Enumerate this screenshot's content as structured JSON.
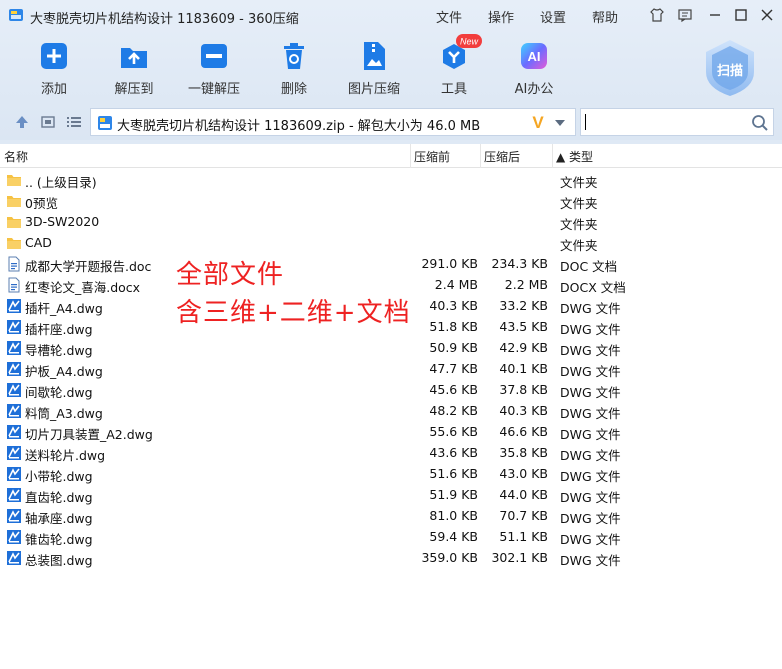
{
  "window": {
    "title": "大枣脱壳切片机结构设计 1183609 - 360压缩",
    "menus": [
      "文件",
      "操作",
      "设置",
      "帮助"
    ]
  },
  "toolbar": {
    "items": [
      {
        "label": "添加",
        "icon": "add-icon"
      },
      {
        "label": "解压到",
        "icon": "extract-to-icon"
      },
      {
        "label": "一键解压",
        "icon": "one-click-extract-icon"
      },
      {
        "label": "删除",
        "icon": "trash-icon"
      },
      {
        "label": "图片压缩",
        "icon": "image-compress-icon"
      },
      {
        "label": "工具",
        "icon": "tools-icon",
        "badge": "New"
      },
      {
        "label": "AI办公",
        "icon": "ai-icon",
        "badge_text": "AI"
      }
    ],
    "scan_label": "扫描"
  },
  "address": {
    "path": "大枣脱壳切片机结构设计 1183609.zip - 解包大小为 46.0 MB",
    "v_badge": "V",
    "search_value": ""
  },
  "columns": {
    "name": "名称",
    "packed": "压缩前",
    "compressed": "压缩后",
    "type": "▲ 类型"
  },
  "files": [
    {
      "name": ".. (上级目录)",
      "before": "",
      "after": "",
      "type": "文件夹",
      "kind": "folder"
    },
    {
      "name": "0预览",
      "before": "",
      "after": "",
      "type": "文件夹",
      "kind": "folder"
    },
    {
      "name": "3D-SW2020",
      "before": "",
      "after": "",
      "type": "文件夹",
      "kind": "folder"
    },
    {
      "name": "CAD",
      "before": "",
      "after": "",
      "type": "文件夹",
      "kind": "folder"
    },
    {
      "name": "成都大学开题报告.doc",
      "before": "291.0 KB",
      "after": "234.3 KB",
      "type": "DOC 文档",
      "kind": "doc"
    },
    {
      "name": "红枣论文_喜海.docx",
      "before": "2.4 MB",
      "after": "2.2 MB",
      "type": "DOCX 文档",
      "kind": "doc"
    },
    {
      "name": "插杆_A4.dwg",
      "before": "40.3 KB",
      "after": "33.2 KB",
      "type": "DWG 文件",
      "kind": "dwg"
    },
    {
      "name": "插杆座.dwg",
      "before": "51.8 KB",
      "after": "43.5 KB",
      "type": "DWG 文件",
      "kind": "dwg"
    },
    {
      "name": "导槽轮.dwg",
      "before": "50.9 KB",
      "after": "42.9 KB",
      "type": "DWG 文件",
      "kind": "dwg"
    },
    {
      "name": "护板_A4.dwg",
      "before": "47.7 KB",
      "after": "40.1 KB",
      "type": "DWG 文件",
      "kind": "dwg"
    },
    {
      "name": "间歇轮.dwg",
      "before": "45.6 KB",
      "after": "37.8 KB",
      "type": "DWG 文件",
      "kind": "dwg"
    },
    {
      "name": "料筒_A3.dwg",
      "before": "48.2 KB",
      "after": "40.3 KB",
      "type": "DWG 文件",
      "kind": "dwg"
    },
    {
      "name": "切片刀具装置_A2.dwg",
      "before": "55.6 KB",
      "after": "46.6 KB",
      "type": "DWG 文件",
      "kind": "dwg"
    },
    {
      "name": "送料轮片.dwg",
      "before": "43.6 KB",
      "after": "35.8 KB",
      "type": "DWG 文件",
      "kind": "dwg"
    },
    {
      "name": "小带轮.dwg",
      "before": "51.6 KB",
      "after": "43.0 KB",
      "type": "DWG 文件",
      "kind": "dwg"
    },
    {
      "name": "直齿轮.dwg",
      "before": "51.9 KB",
      "after": "44.0 KB",
      "type": "DWG 文件",
      "kind": "dwg"
    },
    {
      "name": "轴承座.dwg",
      "before": "81.0 KB",
      "after": "70.7 KB",
      "type": "DWG 文件",
      "kind": "dwg"
    },
    {
      "name": "锥齿轮.dwg",
      "before": "59.4 KB",
      "after": "51.1 KB",
      "type": "DWG 文件",
      "kind": "dwg"
    },
    {
      "name": "总装图.dwg",
      "before": "359.0 KB",
      "after": "302.1 KB",
      "type": "DWG 文件",
      "kind": "dwg"
    }
  ],
  "overlay": {
    "line1": "全部文件",
    "line2": "含三维+二维+文档"
  },
  "colors": {
    "accent": "#1e7be6",
    "folder": "#f6c243",
    "overlay_text": "#ee2222",
    "chrome_bg": "#dfe9f5"
  }
}
